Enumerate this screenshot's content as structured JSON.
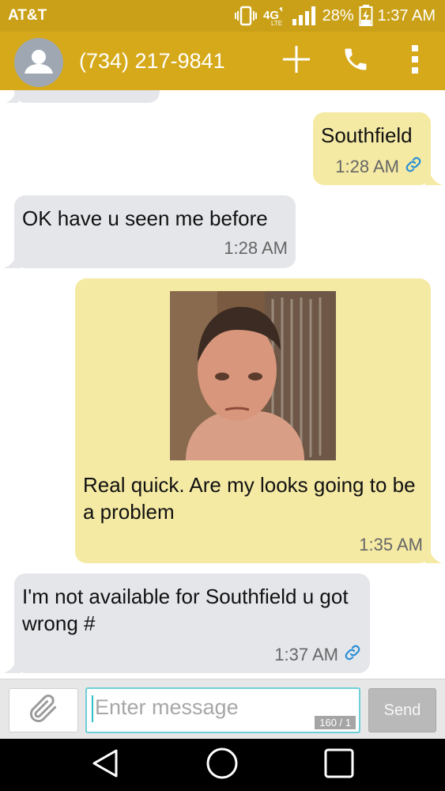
{
  "status_bar": {
    "carrier": "AT&T",
    "network": "4G LTE",
    "battery": "28%",
    "time": "1:37 AM"
  },
  "app_bar": {
    "contact": "(734) 217-9841",
    "icons": [
      "avatar-icon",
      "add-icon",
      "phone-icon",
      "more-icon"
    ]
  },
  "messages": [
    {
      "direction": "outgoing",
      "text": "Southfield",
      "time": "1:28 AM",
      "link_icon": true
    },
    {
      "direction": "incoming",
      "text": "OK have u seen me before",
      "time": "1:28 AM"
    },
    {
      "direction": "outgoing",
      "text": "Real quick. Are my looks going to be a problem",
      "time": "1:35 AM",
      "has_photo": true
    },
    {
      "direction": "incoming",
      "text": "I'm not available for Southfield u got wrong #",
      "time": "1:37 AM",
      "link_icon": true
    }
  ],
  "compose": {
    "placeholder": "Enter message",
    "counter": "160 / 1",
    "send_label": "Send"
  },
  "colors": {
    "header": "#d6a91a",
    "incoming_bubble": "#e4e6ea",
    "outgoing_bubble": "#f5eaa4",
    "link": "#2a8fd6"
  }
}
